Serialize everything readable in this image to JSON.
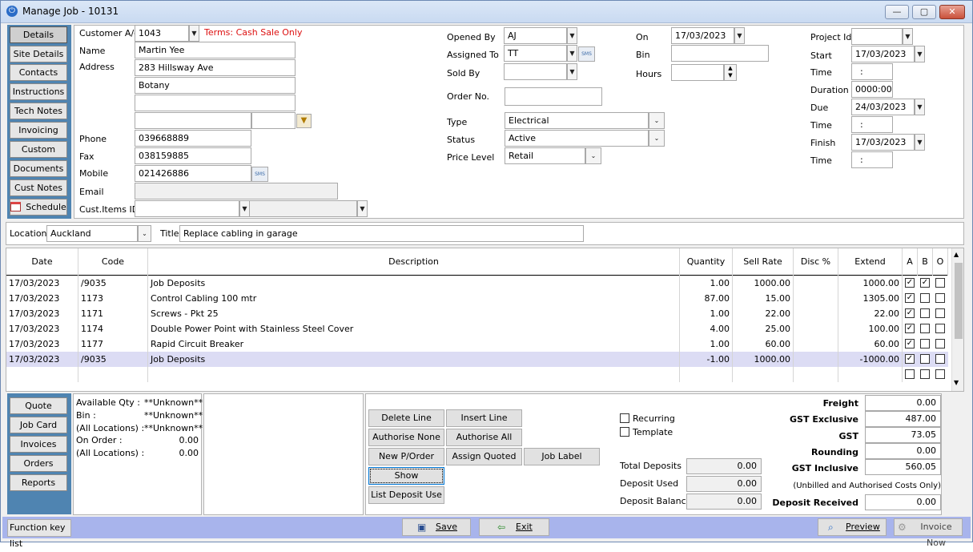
{
  "window": {
    "title": "Manage Job - 10131",
    "min": "—",
    "max": "▢",
    "close": "✕"
  },
  "nav": {
    "top": [
      "Details",
      "Site Details",
      "Contacts",
      "Instructions",
      "Tech Notes",
      "Invoicing",
      "Custom Fields",
      "Documents",
      "Cust Notes",
      "Schedule"
    ],
    "bottom": [
      "Quote",
      "Job Card",
      "Invoices",
      "Orders",
      "Reports"
    ]
  },
  "customer": {
    "account_label": "Customer A/c",
    "account": "1043",
    "terms": "Terms: Cash Sale Only",
    "name_label": "Name",
    "name": "Martin Yee",
    "address_label": "Address",
    "address1": "283 Hillsway Ave",
    "address2": "Botany",
    "address3": "",
    "address4": "",
    "phone_label": "Phone",
    "phone": "039668889",
    "fax_label": "Fax",
    "fax": "038159885",
    "mobile_label": "Mobile",
    "mobile": "021426886",
    "email_label": "Email",
    "email": "",
    "cust_items_label": "Cust.Items ID",
    "cust_items": ""
  },
  "job": {
    "opened_by_label": "Opened By",
    "opened_by": "AJ",
    "assigned_to_label": "Assigned To",
    "assigned_to": "TT",
    "sold_by_label": "Sold By",
    "sold_by": "",
    "order_no_label": "Order No.",
    "order_no": "",
    "on_label": "On",
    "on": "17/03/2023",
    "bin_label": "Bin",
    "bin": "",
    "hours_label": "Hours",
    "hours": "",
    "type_label": "Type",
    "type": "Electrical",
    "status_label": "Status",
    "status": "Active",
    "price_level_label": "Price Level",
    "price_level": "Retail",
    "project_id_label": "Project Id",
    "project_id": "",
    "start_label": "Start",
    "start": "17/03/2023",
    "time_label": "Time",
    "start_time": ":",
    "duration_label": "Duration",
    "duration": "0000:00",
    "due_label": "Due",
    "due": "24/03/2023",
    "due_time": ":",
    "finish_label": "Finish",
    "finish": "17/03/2023",
    "finish_time": ":",
    "location_label": "Location",
    "location": "Auckland",
    "title_label": "Title",
    "title": "Replace cabling in garage"
  },
  "sms": "SMS",
  "grid": {
    "headers": [
      "Date",
      "Code",
      "Description",
      "Quantity",
      "Sell Rate",
      "Disc %",
      "Extend",
      "A",
      "B",
      "O"
    ],
    "rows": [
      {
        "date": "17/03/2023",
        "code": "/9035",
        "desc": "Job Deposits",
        "qty": "1.00",
        "rate": "1000.00",
        "disc": "",
        "extend": "1000.00",
        "a": true,
        "b": true,
        "o": false
      },
      {
        "date": "17/03/2023",
        "code": "1173",
        "desc": "Control Cabling 100 mtr",
        "qty": "87.00",
        "rate": "15.00",
        "disc": "",
        "extend": "1305.00",
        "a": true,
        "b": false,
        "o": false
      },
      {
        "date": "17/03/2023",
        "code": "1171",
        "desc": "Screws - Pkt 25",
        "qty": "1.00",
        "rate": "22.00",
        "disc": "",
        "extend": "22.00",
        "a": true,
        "b": false,
        "o": false
      },
      {
        "date": "17/03/2023",
        "code": "1174",
        "desc": "Double Power Point with Stainless Steel Cover",
        "qty": "4.00",
        "rate": "25.00",
        "disc": "",
        "extend": "100.00",
        "a": true,
        "b": false,
        "o": false
      },
      {
        "date": "17/03/2023",
        "code": "1177",
        "desc": "Rapid Circuit Breaker",
        "qty": "1.00",
        "rate": "60.00",
        "disc": "",
        "extend": "60.00",
        "a": true,
        "b": false,
        "o": false
      },
      {
        "date": "17/03/2023",
        "code": "/9035",
        "desc": "Job Deposits",
        "qty": "-1.00",
        "rate": "1000.00",
        "disc": "",
        "extend": "-1000.00",
        "a": true,
        "b": false,
        "o": false
      }
    ]
  },
  "stock": {
    "available_label": "Available Qty :",
    "available": "**Unknown**",
    "bin_label": "Bin :",
    "bin": "**Unknown**",
    "all_loc_label": "(All Locations) :",
    "all_loc": "**Unknown**",
    "on_order_label": "On Order :",
    "on_order": "0.00",
    "all_loc2_label": "(All Locations) :",
    "all_loc2": "0.00"
  },
  "actions": {
    "delete_line": "Delete Line",
    "insert_line": "Insert Line",
    "authorise_none": "Authorise None",
    "authorise_all": "Authorise All",
    "new_porder": "New P/Order",
    "assign_quoted": "Assign Quoted",
    "job_label": "Job Label",
    "show_costs": "Show Costs/Profit",
    "list_deposit": "List Deposit Use"
  },
  "options": {
    "recurring": "Recurring",
    "template": "Template"
  },
  "deposits": {
    "total_label": "Total Deposits",
    "total": "0.00",
    "used_label": "Deposit Used",
    "used": "0.00",
    "balance_label": "Deposit Balance",
    "balance": "0.00"
  },
  "totals": {
    "freight_label": "Freight",
    "freight": "0.00",
    "gst_ex_label": "GST Exclusive",
    "gst_ex": "487.00",
    "gst_label": "GST",
    "gst": "73.05",
    "rounding_label": "Rounding",
    "rounding": "0.00",
    "gst_inc_label": "GST Inclusive",
    "gst_inc": "560.05",
    "note": "(Unbilled and Authorised Costs Only)",
    "deposit_received_label": "Deposit Received",
    "deposit_received": "0.00"
  },
  "footer": {
    "fkeys": "Function key list",
    "save": "Save",
    "exit": "Exit",
    "preview": "Preview",
    "invoice_now": "Invoice Now"
  }
}
